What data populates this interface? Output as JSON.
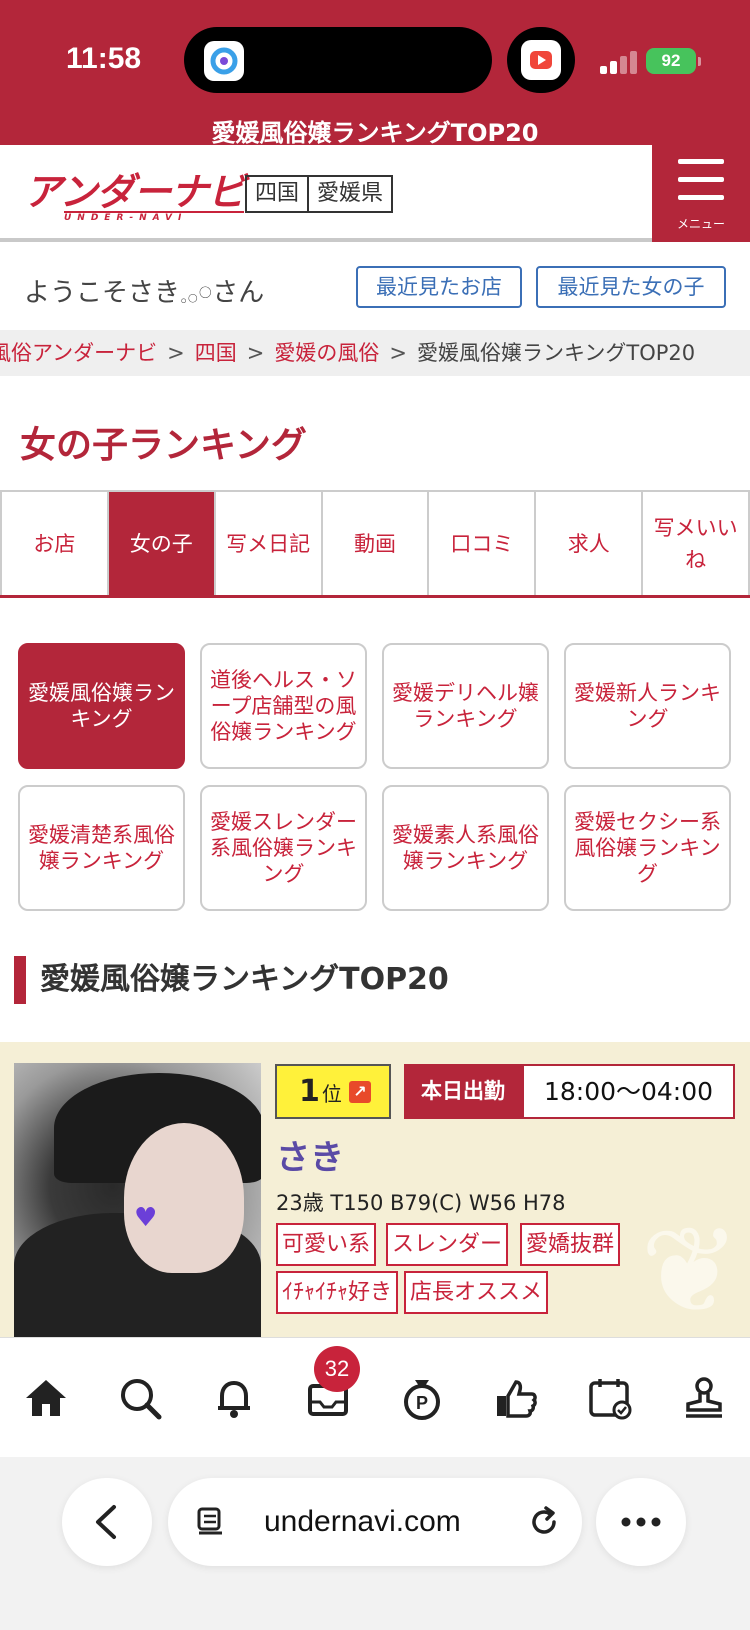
{
  "status": {
    "time": "11:58",
    "battery": "92"
  },
  "page_header_title": "愛媛風俗嬢ランキングTOP20",
  "site": {
    "logo_main": "アンダーナビ",
    "logo_sub": "UNDER-NAVI",
    "region": [
      "四国",
      "愛媛県"
    ],
    "menu_label": "メニュー"
  },
  "welcome_text": "ようこそさき𓈒𓂂𓏸さん",
  "recent_buttons": {
    "shops": "最近見たお店",
    "girls": "最近見た女の子"
  },
  "breadcrumb": {
    "items": [
      "風俗アンダーナビ",
      "四国",
      "愛媛の風俗"
    ],
    "current": "愛媛風俗嬢ランキングTOP20",
    "sep": ">"
  },
  "section_title": "女の子ランキング",
  "tabs": [
    "お店",
    "女の子",
    "写メ日記",
    "動画",
    "口コミ",
    "求人",
    "写メいいね"
  ],
  "active_tab": "女の子",
  "sub_rankings": [
    "愛媛風俗嬢ランキング",
    "道後ヘルス・ソープ店舗型の風俗嬢ランキング",
    "愛媛デリヘル嬢ランキング",
    "愛媛新人ランキング",
    "愛媛清楚系風俗嬢ランキング",
    "愛媛スレンダー系風俗嬢ランキング",
    "愛媛素人系風俗嬢ランキング",
    "愛媛セクシー系風俗嬢ランキング"
  ],
  "ranking_heading": "愛媛風俗嬢ランキングTOP20",
  "card": {
    "rank_number": "1",
    "rank_unit": "位",
    "rank_arrow": "↗",
    "shift_label": "本日出勤",
    "shift_time": "18:00〜04:00",
    "name": "さき",
    "spec": "23歳 T150 B79(C) W56 H78",
    "tags": [
      "可愛い系",
      "スレンダー",
      "愛嬌抜群",
      "ｲﾁｬｲﾁｬ好き",
      "店長オススメ"
    ]
  },
  "bottom_nav": {
    "icons": [
      "home-icon",
      "search-icon",
      "bell-icon",
      "inbox-icon",
      "points-icon",
      "thumbs-up-icon",
      "calendar-icon",
      "stamp-icon"
    ],
    "badge_count": "32"
  },
  "browser": {
    "url": "undernavi.com"
  },
  "colors": {
    "brand": "#b3263a",
    "accent_text": "#c8233b",
    "link_blue": "#3b6fb6",
    "badge_yellow": "#fff13a"
  }
}
